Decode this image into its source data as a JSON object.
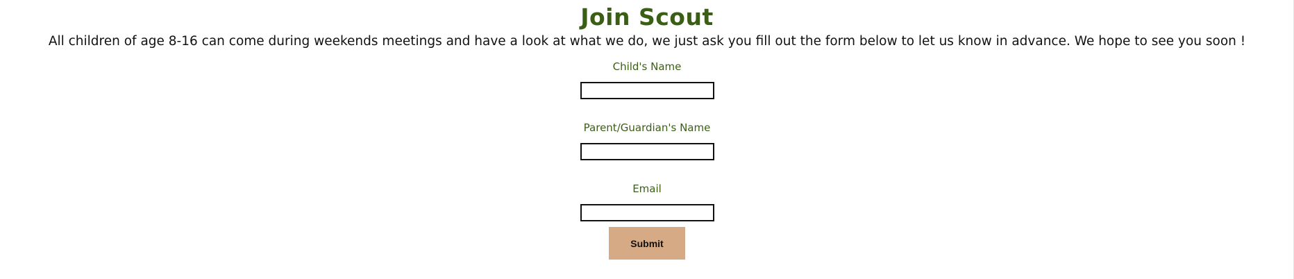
{
  "page": {
    "title": "Join Scout",
    "intro": "All children of age 8-16 can come during weekends meetings and have a look at what we do, we just ask you fill out the form below to let us know in advance. We hope to see you soon !"
  },
  "form": {
    "fields": [
      {
        "label": "Child's Name",
        "value": "",
        "placeholder": ""
      },
      {
        "label": "Parent/Guardian's Name",
        "value": "",
        "placeholder": ""
      },
      {
        "label": "Email",
        "value": "",
        "placeholder": ""
      }
    ],
    "submit_label": "Submit"
  },
  "colors": {
    "heading": "#3b5e15",
    "text": "#111111",
    "button_bg": "#d6aa84",
    "background": "#ffffff"
  }
}
